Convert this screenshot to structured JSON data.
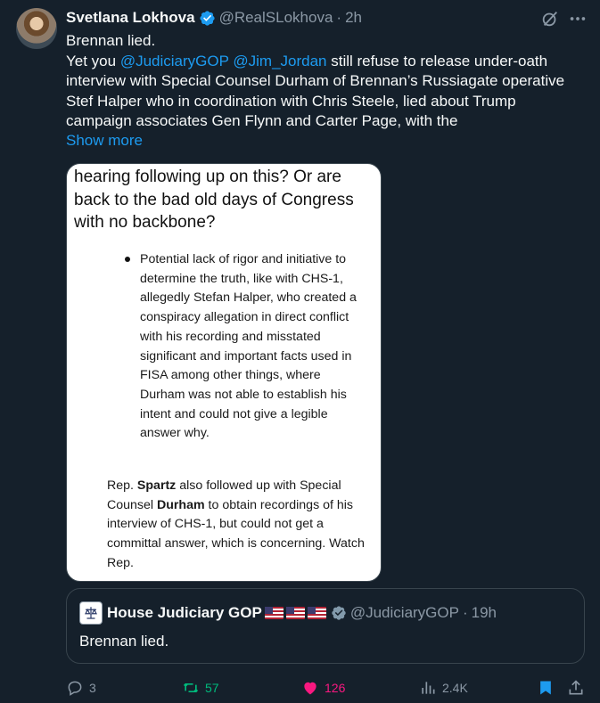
{
  "tweet": {
    "author_name": "Svetlana Lokhova",
    "handle": "@RealSLokhova",
    "separator": "·",
    "time": "2h",
    "line1": "Brennan lied.",
    "line2_pre": "Yet you ",
    "mention1": "@JudiciaryGOP",
    "mention_gap": " ",
    "mention2": "@Jim_Jordan",
    "line2_post": " still refuse to release under-oath interview with Special Counsel Durham of Brennan’s Russiagate operative Stef Halper who in coordination with Chris Steele, lied about Trump campaign  associates Gen Flynn and Carter Page, with the",
    "show_more": "Show more"
  },
  "image": {
    "heading": "hearing following up on this? Or are back to the bad old days of Congress with no backbone?",
    "bullet": "Potential lack of rigor and initiative to determine the truth, like with CHS-1, allegedly Stefan Halper, who created a conspiracy allegation in direct conflict with his recording and misstated significant and important facts used in FISA among other things, where Durham was not able to establish his intent and could not give a legible answer why.",
    "para_1": "Rep. ",
    "para_bold1": "Spartz",
    "para_2": " also followed up with Special Counsel ",
    "para_bold2": "Durham",
    "para_3": " to obtain recordings of his interview of CHS-1, but could not get a committal answer, which is concerning. Watch Rep."
  },
  "quote": {
    "name": "House Judiciary GOP",
    "handle": "@JudiciaryGOP",
    "separator": "·",
    "time": "19h",
    "text": "Brennan lied."
  },
  "actions": {
    "replies": "3",
    "retweets": "57",
    "likes": "126",
    "views": "2.4K"
  },
  "colors": {
    "background": "#15202b",
    "link": "#1d9bf0",
    "muted": "#8b98a5",
    "retweet_active": "#00ba7c",
    "like_active": "#f91880"
  },
  "icons": [
    "verified-badge-icon",
    "grok-icon",
    "more-icon",
    "reply-icon",
    "retweet-icon",
    "like-icon",
    "views-icon",
    "bookmark-icon",
    "share-icon",
    "us-flag-icon"
  ]
}
